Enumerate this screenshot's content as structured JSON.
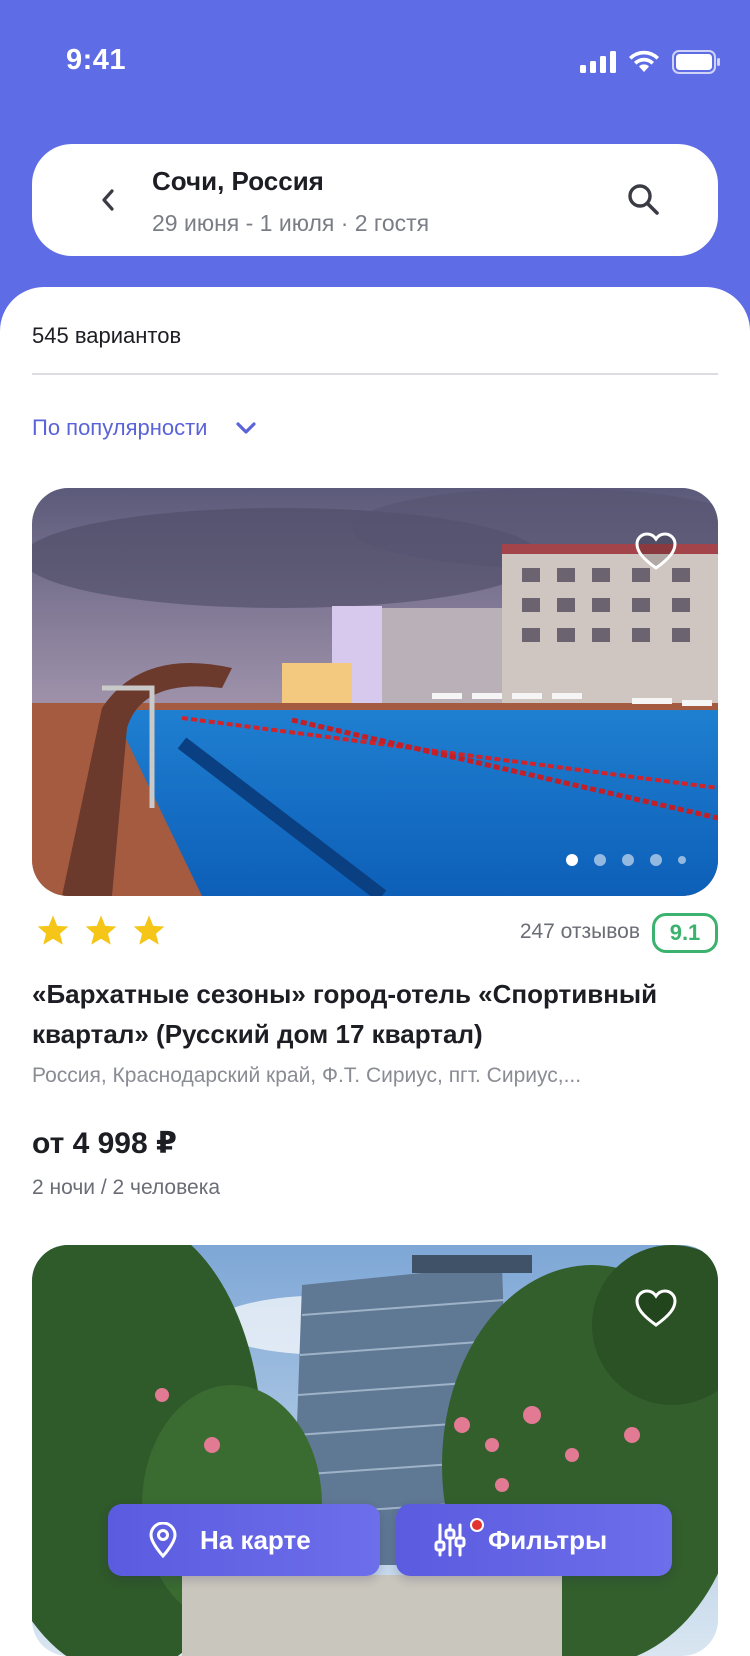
{
  "status_bar": {
    "time": "9:41"
  },
  "search": {
    "title": "Сочи, Россия",
    "subtitle": "29 июня - 1 июля · 2 гостя"
  },
  "results": {
    "count_label": "545 вариантов",
    "sort_label": "По популярности"
  },
  "hotels": [
    {
      "stars": 3,
      "reviews_label": "247 отзывов",
      "rating": "9.1",
      "name": "«Бархатные сезоны» город-отель «Спортивный квартал» (Русский дом 17 квартал)",
      "address": "Россия, Краснодарский край, Ф.Т. Сириус, пгт. Сириус,...",
      "price": "от 4 998 ₽",
      "price_note": "2 ночи / 2 человека",
      "photo_dots": 5,
      "active_dot": 0
    }
  ],
  "floating_actions": {
    "map_label": "На карте",
    "filter_label": "Фильтры"
  },
  "colors": {
    "brand": "#5E6CE6",
    "accent_text": "#5A63D8",
    "rating_green": "#3BB36E",
    "star": "#F5C518",
    "filter_badge": "#E23232"
  },
  "icons": {
    "back": "chevron-left-icon",
    "search": "search-icon",
    "sort": "chevron-down-icon",
    "favorite": "heart-outline-icon",
    "map": "location-pin-icon",
    "filter": "sliders-icon"
  }
}
